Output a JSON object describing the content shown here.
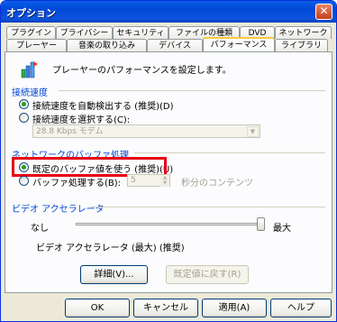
{
  "window": {
    "title": "オプション",
    "close_glyph": "✕"
  },
  "tabs": {
    "row1": [
      "プラグイン",
      "プライバシー",
      "セキュリティ",
      "ファイルの種類",
      "DVD",
      "ネットワーク"
    ],
    "row2": [
      "プレーヤー",
      "音楽の取り込み",
      "デバイス",
      "パフォーマンス",
      "ライブラリ"
    ],
    "active": "パフォーマンス"
  },
  "panel": {
    "description": "プレーヤーのパフォーマンスを設定します。",
    "connection": {
      "heading": "接続速度",
      "auto_detect_label": "接続速度を自動検出する (推奨)(D)",
      "auto_detect_selected": true,
      "choose_label": "接続速度を選択する(C):",
      "choose_selected": false,
      "speed_value": "28.8 Kbps モデム"
    },
    "buffer": {
      "heading": "ネットワークのバッファ処理",
      "default_label": "既定のバッファ値を使う (推奨)(U)",
      "default_selected": true,
      "custom_label": "バッファ処理する(B):",
      "custom_selected": false,
      "seconds_value": "5",
      "seconds_suffix": "秒分のコンテンツ"
    },
    "video_accel": {
      "heading": "ビデオ アクセラレータ",
      "min_label": "なし",
      "max_label": "最大",
      "level_fraction": 1.0,
      "status_text": "ビデオ アクセラレータ (最大) (推奨)"
    },
    "advanced_button": "詳細(V)...",
    "restore_button": "既定値に戻す(R)"
  },
  "footer": {
    "ok": "OK",
    "cancel": "キャンセル",
    "apply": "適用(A)",
    "help": "ヘルプ"
  },
  "colors": {
    "accent_heading": "#0046d5",
    "highlight_box": "#e60012",
    "titlebar": "#0a5de8"
  }
}
